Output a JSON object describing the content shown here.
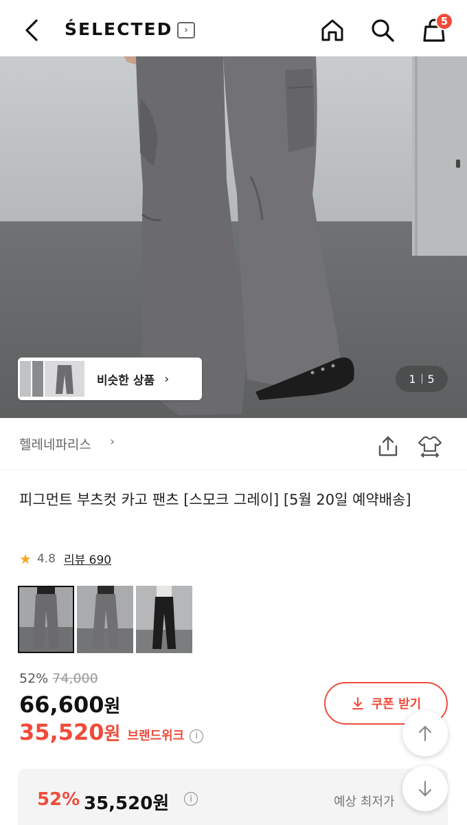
{
  "header": {
    "logo": "ŚELECTED",
    "logo_arrow": "›",
    "cart_count": "5"
  },
  "hero": {
    "similar_label": "비슷한 상품",
    "similar_arrow": "›",
    "page_current": "1",
    "page_total": "5"
  },
  "brand": {
    "name": "헬레네파리스",
    "chevron": "›"
  },
  "product": {
    "title": "피그먼트 부츠컷 카고 팬츠 [스모크 그레이] [5월 20일 예약배송]",
    "rating": "4.8",
    "reviews": "리뷰 690",
    "color_options": [
      "smoke-gray-1",
      "smoke-gray-2",
      "black"
    ]
  },
  "price": {
    "discount_pct": "52%",
    "original": "74,000",
    "current": "66,600",
    "unit": "원",
    "brandweek_price": "35,520",
    "brandweek_tag": "브랜드위크",
    "info": "i",
    "coupon_label": "쿠폰 받기"
  },
  "best": {
    "pct": "52%",
    "amount": "35,520원",
    "label": "예상 최저가"
  },
  "colors": {
    "accent": "#ef4b3a",
    "pants_gray": "#6b6b6d"
  }
}
